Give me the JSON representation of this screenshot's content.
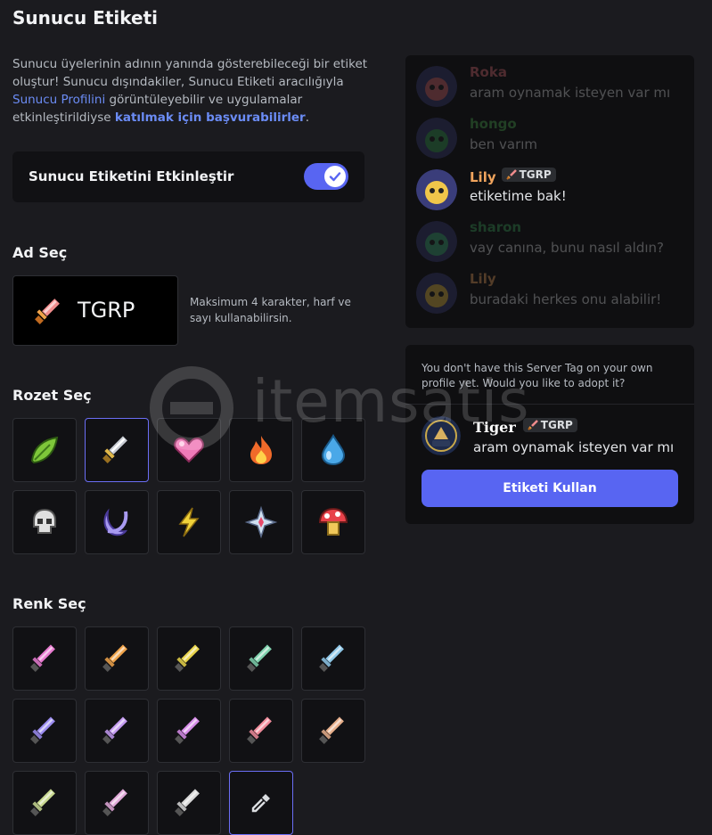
{
  "page": {
    "title": "Sunucu Etiketi",
    "description": {
      "part1": "Sunucu üyelerinin adının yanında gösterebileceği bir etiket oluştur! Sunucu dışındakiler, Sunucu Etiketi aracılığıyla ",
      "link1": "Sunucu Profilini",
      "part2": " görüntüleyebilir ve uygulamalar etkinleştirildiyse ",
      "link2": "katılmak için başvurabilirler",
      "part3": "."
    }
  },
  "toggle": {
    "label": "Sunucu Etiketini Etkinleştir",
    "enabled": true
  },
  "name_section": {
    "heading": "Ad Seç",
    "tag_text": "TGRP",
    "hint": "Maksimum 4 karakter, harf ve sayı kullanabilirsin."
  },
  "badge_section": {
    "heading": "Rozet Seç",
    "badges": [
      "leaf-icon",
      "sword-icon",
      "heart-icon",
      "fire-icon",
      "water-drop-icon",
      "skull-icon",
      "moon-icon",
      "lightning-icon",
      "sparkle-icon",
      "mushroom-icon"
    ],
    "selected_index": 1
  },
  "color_section": {
    "heading": "Renk Seç",
    "swatches": [
      "#e87bd0",
      "#f0a34a",
      "#e8d34a",
      "#7fd1ad",
      "#8fc8e8",
      "#9b8cf0",
      "#c39af0",
      "#d68ce8",
      "#f08c9b",
      "#e8b08c",
      "#c8d890",
      "#e0a8d8",
      "#d8d8d8"
    ],
    "eyedropper_icon": "eyedropper-icon"
  },
  "chat_preview": {
    "messages": [
      {
        "user": "Roka",
        "text": "aram oynamak isteyen var mı",
        "dim": true,
        "color": "#e06c75"
      },
      {
        "user": "hongo",
        "text": "ben varım",
        "dim": true,
        "color": "#4caf50"
      },
      {
        "user": "Lily",
        "text": "etiketime bak!",
        "dim": false,
        "color": "#f0a45d",
        "tag": "TGRP"
      },
      {
        "user": "sharon",
        "text": "vay canına, bunu nasıl aldın?",
        "dim": true,
        "color": "#3ba55c"
      },
      {
        "user": "Lily",
        "text": "buradaki herkes onu alabilir!",
        "dim": true,
        "color": "#f0a45d"
      }
    ]
  },
  "adopt_card": {
    "question": "You don't have this Server Tag on your own profile yet. Would you like to adopt it?",
    "user": "Tiger",
    "tag": "TGRP",
    "message": "aram oynamak isteyen var mı",
    "button": "Etiketi Kullan"
  },
  "watermark": "itemsatis"
}
